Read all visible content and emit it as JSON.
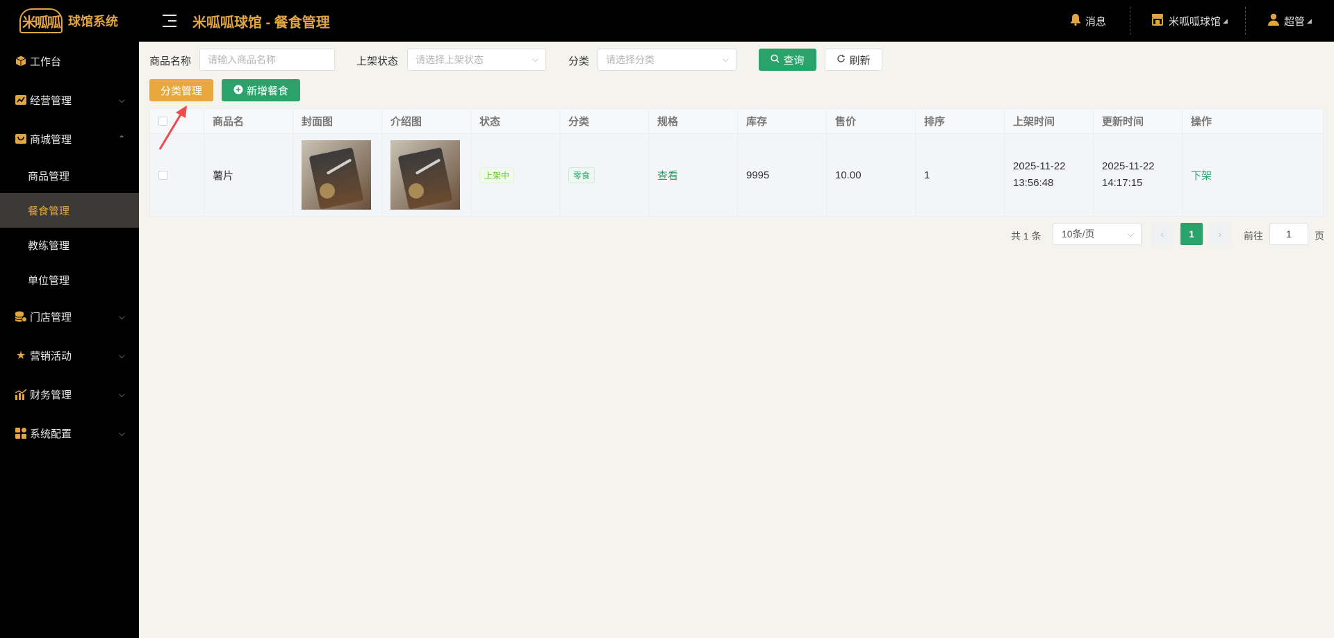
{
  "header": {
    "logo_text": "米呱呱",
    "brand": "球馆系统",
    "title": "米呱呱球馆 - 餐食管理",
    "messages": "消息",
    "venue": "米呱呱球馆",
    "user": "超管",
    "accent_color": "#e3a442"
  },
  "sidebar": {
    "items": [
      {
        "label": "工作台",
        "icon": "cube-icon"
      },
      {
        "label": "经营管理",
        "icon": "chart-badge-icon"
      },
      {
        "label": "商城管理",
        "icon": "shopping-bag-icon",
        "expanded": true,
        "children": [
          "商品管理",
          "餐食管理",
          "教练管理",
          "单位管理"
        ],
        "active_child": "餐食管理"
      },
      {
        "label": "门店管理",
        "icon": "coins-icon"
      },
      {
        "label": "营销活动",
        "icon": "star-icon"
      },
      {
        "label": "财务管理",
        "icon": "bar-chart-icon"
      },
      {
        "label": "系统配置",
        "icon": "grid-icon"
      }
    ]
  },
  "filters": {
    "name_label": "商品名称",
    "name_placeholder": "请输入商品名称",
    "status_label": "上架状态",
    "status_placeholder": "请选择上架状态",
    "category_label": "分类",
    "category_placeholder": "请选择分类",
    "query_button": "查询",
    "refresh_button": "刷新"
  },
  "actions": {
    "category_button": "分类管理",
    "add_button": "新增餐食"
  },
  "table": {
    "columns": [
      "商品名",
      "封面图",
      "介绍图",
      "状态",
      "分类",
      "规格",
      "库存",
      "售价",
      "排序",
      "上架时间",
      "更新时间",
      "操作"
    ],
    "rows": [
      {
        "name": "薯片",
        "status": "上架中",
        "category": "零食",
        "spec": "查看",
        "stock": "9995",
        "price": "10.00",
        "sort": "1",
        "listed_date": "2025-11-22",
        "listed_time": "13:56:48",
        "updated_date": "2025-11-22",
        "updated_time": "14:17:15",
        "action": "下架"
      }
    ]
  },
  "pagination": {
    "total": "共 1 条",
    "page_size": "10条/页",
    "current_page": "1",
    "goto_label": "前往",
    "goto_value": "1",
    "page_suffix": "页"
  }
}
